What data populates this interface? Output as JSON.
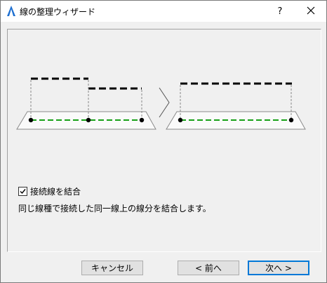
{
  "window": {
    "title": "線の整理ウィザード",
    "help_label": "?"
  },
  "options": {
    "merge_connected_label": "接続線を結合",
    "merge_connected_checked": true,
    "description": "同じ線種で接続した同一線上の線分を結合します。"
  },
  "buttons": {
    "cancel": "キャンセル",
    "back": "< 前へ",
    "next": "次へ >"
  },
  "colors": {
    "accent": "#0078d7",
    "guide_line": "#16a016"
  }
}
